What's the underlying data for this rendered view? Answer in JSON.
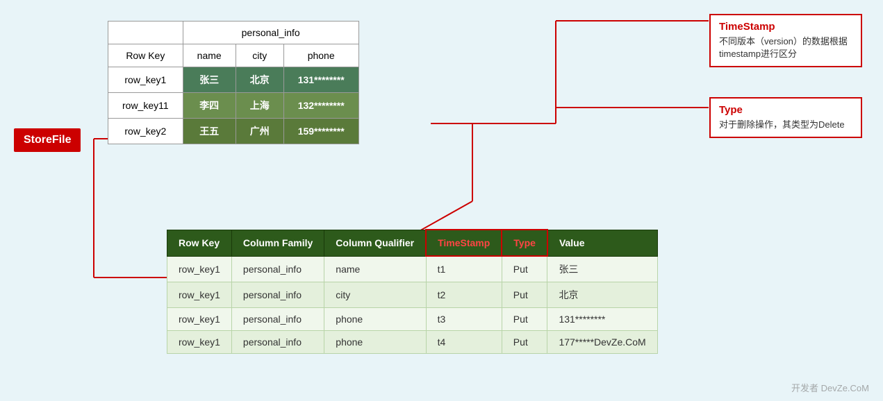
{
  "storefile": {
    "label": "StoreFile"
  },
  "topTable": {
    "spanHeader": "personal_info",
    "columns": [
      "Row Key",
      "name",
      "city",
      "phone"
    ],
    "rows": [
      {
        "key": "row_key1",
        "name": "张三",
        "city": "北京",
        "phone": "131********"
      },
      {
        "key": "row_key11",
        "name": "李四",
        "city": "上海",
        "phone": "132********"
      },
      {
        "key": "row_key2",
        "name": "王五",
        "city": "广州",
        "phone": "159********"
      }
    ]
  },
  "bottomTable": {
    "headers": [
      "Row Key",
      "Column Family",
      "Column Qualifier",
      "TimeStamp",
      "Type",
      "Value"
    ],
    "rows": [
      {
        "rowKey": "row_key1",
        "columnFamily": "personal_info",
        "qualifier": "name",
        "timestamp": "t1",
        "type": "Put",
        "value": "张三"
      },
      {
        "rowKey": "row_key1",
        "columnFamily": "personal_info",
        "qualifier": "city",
        "timestamp": "t2",
        "type": "Put",
        "value": "北京"
      },
      {
        "rowKey": "row_key1",
        "columnFamily": "personal_info",
        "qualifier": "phone",
        "timestamp": "t3",
        "type": "Put",
        "value": "131********"
      },
      {
        "rowKey": "row_key1",
        "columnFamily": "personal_info",
        "qualifier": "phone",
        "timestamp": "t4",
        "type": "Put",
        "value": "177*****DevZe.CoM"
      }
    ]
  },
  "annotations": {
    "timestamp": {
      "title": "TimeStamp",
      "content": "不同版本（version）的数据根据timestamp进行区分"
    },
    "type": {
      "title": "Type",
      "content": "对于删除操作，其类型为Delete"
    }
  },
  "watermark": "开发者 DevZe.CoM"
}
